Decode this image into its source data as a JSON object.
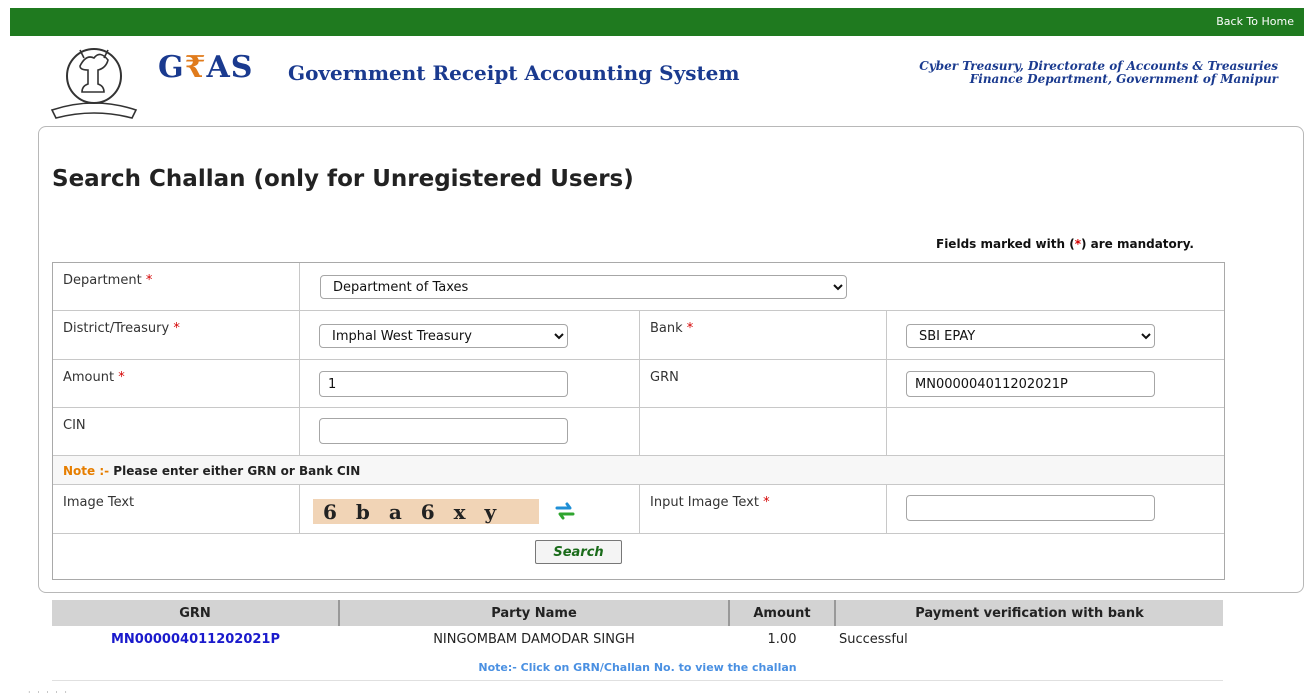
{
  "topbar": {
    "back_link": "Back To Home"
  },
  "header": {
    "logo_g": "G",
    "logo_rupee": "₹",
    "logo_as": "AS",
    "app_title": "Government Receipt Accounting System",
    "dept_line1": "Cyber Treasury, Directorate of Accounts & Treasuries",
    "dept_line2": "Finance Department, Government of Manipur"
  },
  "page": {
    "title": "Search Challan (only for Unregistered Users)",
    "mandatory_prefix": "Fields marked with (",
    "mandatory_star": "*",
    "mandatory_suffix": ") are mandatory."
  },
  "form": {
    "department": {
      "label": "Department",
      "required": "*",
      "value": "Department of Taxes"
    },
    "district": {
      "label": "District/Treasury",
      "required": "*",
      "value": "Imphal West Treasury"
    },
    "bank": {
      "label": "Bank",
      "required": "*",
      "value": "SBI EPAY"
    },
    "amount": {
      "label": "Amount",
      "required": "*",
      "value": "1"
    },
    "grn": {
      "label": "GRN",
      "value": "MN000004011202021P"
    },
    "cin": {
      "label": "CIN",
      "value": ""
    },
    "note_tag": "Note :-",
    "note_text": " Please enter either GRN or Bank CIN",
    "image_text": {
      "label": "Image Text",
      "captcha": "6 b a 6 x y"
    },
    "input_image_text": {
      "label": "Input Image Text",
      "required": "*",
      "value": ""
    },
    "search_button": "Search"
  },
  "results": {
    "headers": [
      "GRN",
      "Party Name",
      "Amount",
      "Payment verification with bank"
    ],
    "rows": [
      {
        "grn": "MN000004011202021P",
        "party_name": "NINGOMBAM DAMODAR SINGH",
        "amount": "1.00",
        "status": "Successful"
      }
    ],
    "note": "Note:- Click on GRN/Challan No. to view the challan"
  },
  "footer": {
    "dots": "· · · · ·"
  },
  "icons": {
    "emblem": "kangla-sha-emblem-icon",
    "refresh": "refresh-icon"
  },
  "colors": {
    "topbar": "#1f7a1f",
    "brand_blue": "#1a3a8f",
    "required_red": "#d40000",
    "note_orange": "#e67e00"
  }
}
